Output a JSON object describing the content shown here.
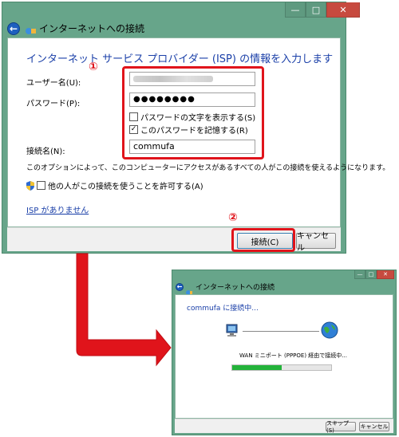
{
  "dialog": {
    "nav_title": "インターネットへの接続",
    "heading": "インターネット サービス プロバイダー (ISP) の情報を入力します",
    "username_label": "ユーザー名(U):",
    "username_value": "",
    "password_label": "パスワード(P):",
    "password_value": "●●●●●●●●",
    "show_password_label": "パスワードの文字を表示する(S)",
    "show_password_checked": false,
    "remember_password_label": "このパスワードを記憶する(R)",
    "remember_password_checked": true,
    "connection_name_label": "接続名(N):",
    "connection_name_value": "commufa",
    "option_note": "このオプションによって、このコンピューターにアクセスがあるすべての人がこの接続を使えるようになります。",
    "allow_others_label": "他の人がこの接続を使うことを許可する(A)",
    "allow_others_checked": false,
    "no_isp_link": "ISP がありません",
    "connect_button": "接続(C)",
    "cancel_button": "キャンセル"
  },
  "annotations": {
    "marker_1": "①",
    "marker_2": "②"
  },
  "progress_dialog": {
    "nav_title": "インターネットへの接続",
    "heading": "commufa に接続中...",
    "status": "WAN ミニポート (PPPOE) 経由で接続中...",
    "progress_fraction": 0.5,
    "skip_button": "スキップ(S)",
    "cancel_button": "キャンセル"
  },
  "window_controls": {
    "minimize": "—",
    "maximize": "□",
    "close": "✕"
  },
  "colors": {
    "frame": "#67a58a",
    "heading": "#1a3fa8",
    "annotation_red": "#e0141b",
    "progress": "#23b33a"
  }
}
